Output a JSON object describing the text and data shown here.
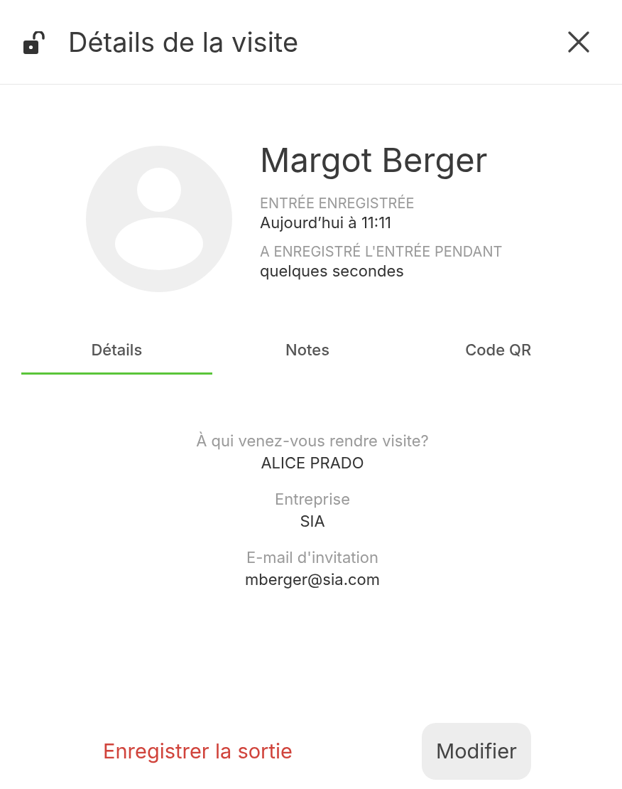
{
  "header": {
    "title": "Détails de la visite"
  },
  "visitor": {
    "name": "Margot Berger",
    "info": [
      {
        "label": "ENTRÉE ENREGISTRÉE",
        "value": "Aujourd’hui à 11:11"
      },
      {
        "label": "A ENREGISTRÉ L'ENTRÉE PENDANT",
        "value": "quelques secondes"
      }
    ]
  },
  "tabs": [
    {
      "label": "Détails",
      "selected": true
    },
    {
      "label": "Notes",
      "selected": false
    },
    {
      "label": "Code QR",
      "selected": false
    }
  ],
  "details": [
    {
      "label": "À qui venez-vous rendre visite?",
      "value": "ALICE PRADO"
    },
    {
      "label": "Entreprise",
      "value": "SIA"
    },
    {
      "label": "E-mail d'invitation",
      "value": "mberger@sia.com"
    }
  ],
  "footer": {
    "checkout": "Enregistrer la sortie",
    "edit": "Modifier"
  }
}
